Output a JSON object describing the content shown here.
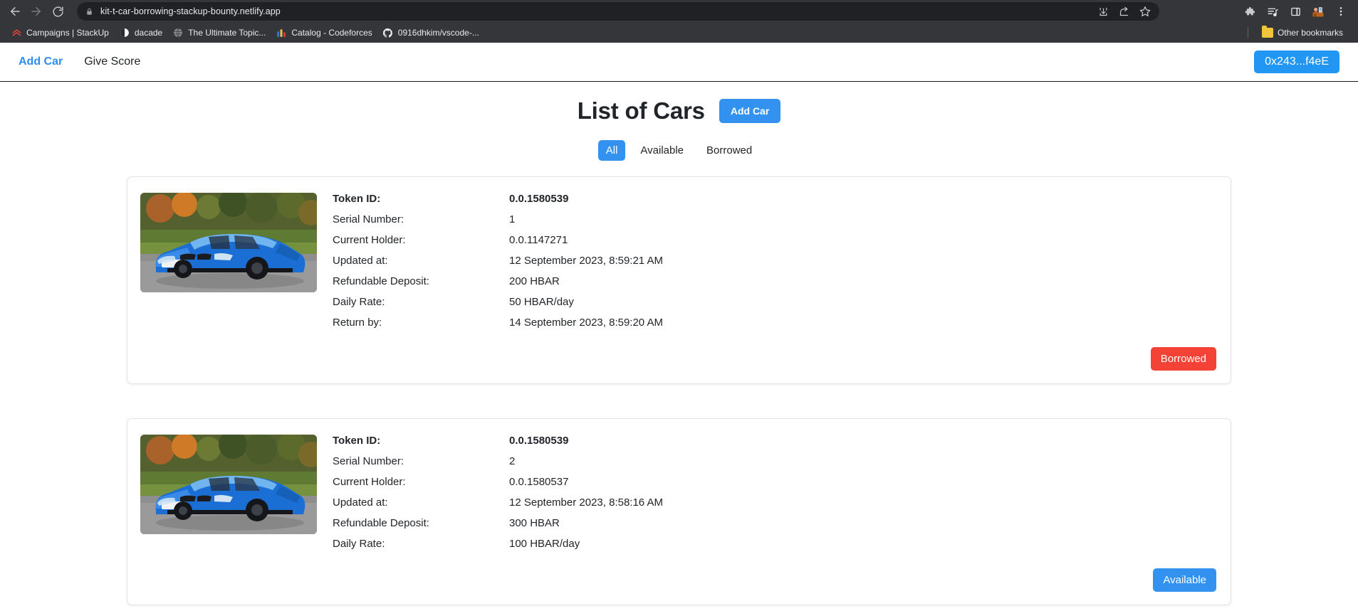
{
  "browser": {
    "url": "kit-t-car-borrowing-stackup-bounty.netlify.app",
    "back_icon": "back-arrow-icon",
    "forward_icon": "forward-arrow-icon",
    "reload_icon": "reload-icon",
    "lock_icon": "lock-icon",
    "omnibox_actions": [
      "install-app-icon",
      "share-icon",
      "bookmark-star-icon"
    ],
    "toolbar_actions": [
      "extensions-puzzle-icon",
      "reading-list-icon",
      "side-panel-icon",
      "profile-avatar-icon",
      "chrome-menu-icon"
    ],
    "bookmarks": [
      {
        "label": "Campaigns | StackUp",
        "icon": "stackup-favicon"
      },
      {
        "label": "dacade",
        "icon": "dacade-favicon"
      },
      {
        "label": "The Ultimate Topic...",
        "icon": "globe-favicon"
      },
      {
        "label": "Catalog - Codeforces",
        "icon": "codeforces-favicon"
      },
      {
        "label": "0916dhkim/vscode-...",
        "icon": "github-favicon"
      }
    ],
    "other_bookmarks": {
      "label": "Other bookmarks",
      "icon": "folder-icon"
    }
  },
  "navbar": {
    "links": [
      {
        "label": "Add Car",
        "active": true
      },
      {
        "label": "Give Score",
        "active": false
      }
    ],
    "wallet_label": "0x243...f4eE"
  },
  "main": {
    "title": "List of Cars",
    "add_car_label": "Add Car",
    "filters": [
      {
        "label": "All",
        "active": true
      },
      {
        "label": "Available",
        "active": false
      },
      {
        "label": "Borrowed",
        "active": false
      }
    ],
    "labels": {
      "token_id": "Token ID:",
      "serial_number": "Serial Number:",
      "current_holder": "Current Holder:",
      "updated_at": "Updated at:",
      "refundable_deposit": "Refundable Deposit:",
      "daily_rate": "Daily Rate:",
      "return_by": "Return by:"
    },
    "cars": [
      {
        "image_alt": "blue-bmw-sedan-photo",
        "token_id": "0.0.1580539",
        "serial_number": "1",
        "current_holder": "0.0.1147271",
        "updated_at": "12 September 2023, 8:59:21 AM",
        "refundable_deposit": "200 HBAR",
        "daily_rate": "50 HBAR/day",
        "return_by": "14 September 2023, 8:59:20 AM",
        "status": "Borrowed",
        "status_kind": "borrowed"
      },
      {
        "image_alt": "blue-bmw-sedan-photo",
        "token_id": "0.0.1580539",
        "serial_number": "2",
        "current_holder": "0.0.1580537",
        "updated_at": "12 September 2023, 8:58:16 AM",
        "refundable_deposit": "300 HBAR",
        "daily_rate": "100 HBAR/day",
        "return_by": null,
        "status": "Available",
        "status_kind": "available"
      }
    ]
  },
  "colors": {
    "accent_blue": "#3391ef",
    "wallet_blue": "#2196f3",
    "borrowed_red": "#f44336",
    "chrome_bg": "#35363a",
    "omnibox_bg": "#202124"
  }
}
